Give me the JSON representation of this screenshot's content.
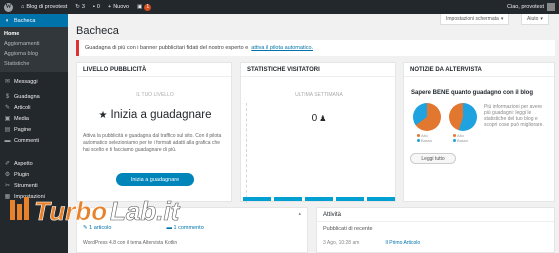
{
  "adminbar": {
    "site_name": "Blog di provotest",
    "updates_count": "3",
    "comments_count": "0",
    "new_label": "Nuovo",
    "notification_count": "1",
    "greeting": "Ciao, provotest"
  },
  "sidebar": {
    "items": [
      {
        "label": "Bacheca",
        "icon": "dashboard-icon",
        "glyph": "◐"
      },
      {
        "label": "Messaggi",
        "icon": "messages-icon",
        "glyph": "✉"
      },
      {
        "label": "Guadagna",
        "icon": "earn-icon",
        "glyph": "$"
      },
      {
        "label": "Articoli",
        "icon": "pin-icon",
        "glyph": "✎"
      },
      {
        "label": "Media",
        "icon": "media-icon",
        "glyph": "▣"
      },
      {
        "label": "Pagine",
        "icon": "pages-icon",
        "glyph": "▤"
      },
      {
        "label": "Commenti",
        "icon": "comments-icon",
        "glyph": "▬"
      },
      {
        "label": "Aspetto",
        "icon": "appearance-icon",
        "glyph": "✐"
      },
      {
        "label": "Plugin",
        "icon": "plugin-icon",
        "glyph": "⚙"
      },
      {
        "label": "Strumenti",
        "icon": "tools-icon",
        "glyph": "✂"
      },
      {
        "label": "Impostazioni",
        "icon": "settings-icon",
        "glyph": "▦"
      }
    ],
    "submenu": [
      "Home",
      "Aggiornamenti",
      "Aggiorna blog",
      "Statistiche"
    ]
  },
  "header": {
    "screen_options": "Impostazioni schermata",
    "help": "Aiuto",
    "title": "Bacheca"
  },
  "notice": {
    "text": "Guadagna di più con i banner pubblicitari fidati del nostro esperto e",
    "link": "attiva il pilota automatico."
  },
  "panel_ads": {
    "title": "LIVELLO PUBBLICITÀ",
    "mini_label": "IL TUO LIVELLO",
    "headline": "Inizia a guadagnare",
    "description": "Attiva la pubblicità e guadagna dal traffico sul sito. Con il pilota automatico selezioniamo per te i formati adatti alla grafica che hai scelto e ti facciamo guadagnare di più.",
    "button": "Inizia a guadagnare"
  },
  "panel_stats": {
    "title": "STATISTICHE VISITATORI",
    "mini_label": "ULTIMA SETTIMANA",
    "visitors": "0"
  },
  "panel_news": {
    "title": "NOTIZIE DA ALTERVISTA",
    "headline": "Sapere BENE quanto guadagno con il blog",
    "text": "Più informazioni per avere più guadagni: leggi le statistiche del tuo blog e scopri cose può migliorare.",
    "button": "Leggi tutto",
    "legend_a": [
      "Alto",
      "Basso"
    ],
    "legend_b": [
      "Alto",
      "Basso"
    ]
  },
  "panel_glance": {
    "articles": "1 articolo",
    "comments": "1 commento",
    "wp_info": "WordPress 4.8 con il tema Altervista Kotlin"
  },
  "panel_activity": {
    "title": "Attività",
    "subtitle": "Pubblicati di recente",
    "date": "3 Ago, 10:28 am",
    "post": "Il Primo Articolo"
  },
  "watermark": {
    "text_a": "Turbo",
    "text_b": "Lab.it"
  },
  "colors": {
    "adminbar": "#23282d",
    "accent": "#0073aa",
    "button": "#0085ba",
    "notice_border": "#dc3232",
    "watermark_orange": "#e8822a"
  }
}
